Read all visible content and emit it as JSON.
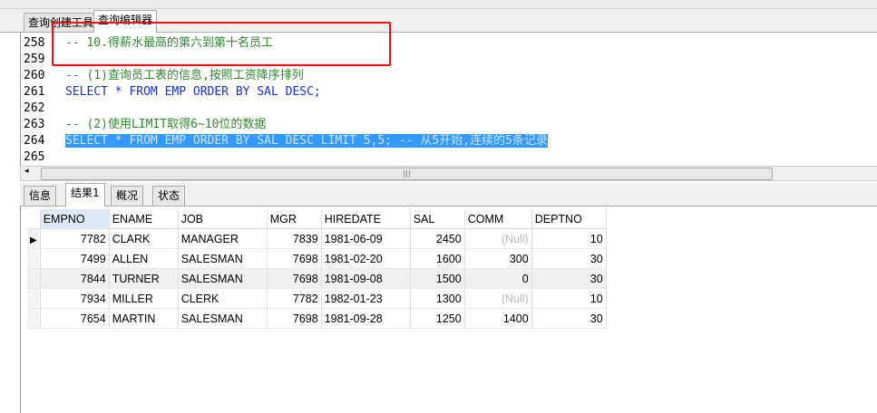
{
  "tabs": [
    "查询创建工具",
    "查询编辑器"
  ],
  "editor": {
    "lines": [
      {
        "n": "258",
        "parts": [
          {
            "c": "cm",
            "t": "-- 10.得薪水最高的第六到第十名员工"
          }
        ]
      },
      {
        "n": "259",
        "parts": []
      },
      {
        "n": "260",
        "parts": [
          {
            "c": "cm",
            "t": "-- (1)查询员工表的信息,按照工资降序排列"
          }
        ]
      },
      {
        "n": "261",
        "parts": [
          {
            "c": "kw",
            "t": "SELECT * FROM EMP ORDER BY SAL DESC;"
          }
        ]
      },
      {
        "n": "262",
        "parts": []
      },
      {
        "n": "263",
        "parts": [
          {
            "c": "cm",
            "t": "-- (2)使用LIMIT取得6~10位的数据"
          }
        ]
      },
      {
        "n": "264",
        "parts": [
          {
            "c": "sel",
            "t": "SELECT * FROM EMP ORDER BY SAL DESC LIMIT 5,5; -- 从5开始,连续的5条记录"
          }
        ]
      },
      {
        "n": "265",
        "parts": []
      }
    ]
  },
  "result_tabs": [
    "信息",
    "结果1",
    "概况",
    "状态"
  ],
  "grid": {
    "columns": [
      "EMPNO",
      "ENAME",
      "JOB",
      "MGR",
      "HIREDATE",
      "SAL",
      "COMM",
      "DEPTNO"
    ],
    "rows": [
      [
        "7782",
        "CLARK",
        "MANAGER",
        "7839",
        "1981-06-09",
        "2450",
        "(Null)",
        "10"
      ],
      [
        "7499",
        "ALLEN",
        "SALESMAN",
        "7698",
        "1981-02-20",
        "1600",
        "300",
        "30"
      ],
      [
        "7844",
        "TURNER",
        "SALESMAN",
        "7698",
        "1981-09-08",
        "1500",
        "0",
        "30"
      ],
      [
        "7934",
        "MILLER",
        "CLERK",
        "7782",
        "1982-01-23",
        "1300",
        "(Null)",
        "10"
      ],
      [
        "7654",
        "MARTIN",
        "SALESMAN",
        "7698",
        "1981-09-28",
        "1250",
        "1400",
        "30"
      ]
    ]
  },
  "colors": {
    "highlight_box": "#f01010",
    "selection": "#3399ff",
    "comment": "#2e8b2e",
    "keyword": "#1b2fd1"
  }
}
